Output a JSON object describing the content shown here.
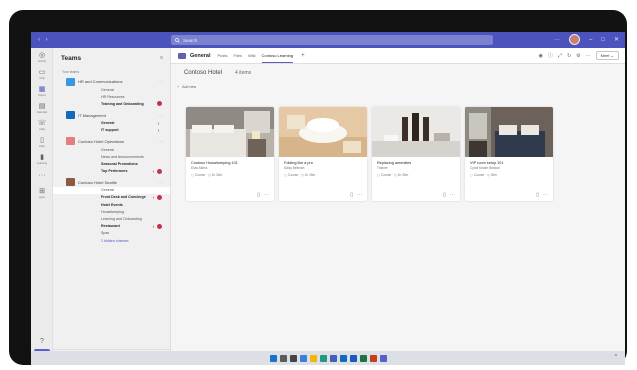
{
  "titlebar": {
    "nav": "‹ ›",
    "search_placeholder": "Search",
    "more": "···",
    "min": "–",
    "max": "□",
    "close": "✕"
  },
  "rail": {
    "items": [
      {
        "label": "Activity",
        "icon": "bell-icon",
        "glyph": "◎"
      },
      {
        "label": "Chat",
        "icon": "chat-icon",
        "glyph": "▭"
      },
      {
        "label": "Teams",
        "icon": "teams-icon",
        "glyph": "▦"
      },
      {
        "label": "Calendar",
        "icon": "calendar-icon",
        "glyph": "▤"
      },
      {
        "label": "Calls",
        "icon": "phone-icon",
        "glyph": "☏"
      },
      {
        "label": "Files",
        "icon": "file-icon",
        "glyph": "▯"
      },
      {
        "label": "Learning",
        "icon": "learning-icon",
        "glyph": "▮"
      },
      {
        "label": "",
        "icon": "more-icon",
        "glyph": "···"
      },
      {
        "label": "Apps",
        "icon": "apps-icon",
        "glyph": "⊞"
      }
    ],
    "help_glyph": "?"
  },
  "teams_panel": {
    "title": "Teams",
    "filter_glyph": "≡",
    "section": "Your teams",
    "teams": [
      {
        "name": "HR and Communications",
        "tile_color": "#3a96dd",
        "channels": [
          {
            "name": "General",
            "bold": false
          },
          {
            "name": "HR Resources",
            "bold": false
          },
          {
            "name": "Training and Onboarding",
            "bold": true,
            "badge": true
          }
        ]
      },
      {
        "name": "IT Management",
        "tile_color": "#0f6cbd",
        "channels": [
          {
            "name": "General",
            "bold": true,
            "mention": "!"
          },
          {
            "name": "IT support",
            "bold": true,
            "mention": "!"
          }
        ]
      },
      {
        "name": "Contoso Hotel Operations",
        "tile_color": "#e37d80",
        "channels": [
          {
            "name": "General",
            "bold": false
          },
          {
            "name": "News and Announcements",
            "bold": false
          },
          {
            "name": "Seasonal Promotions",
            "bold": true
          },
          {
            "name": "Top Performers",
            "bold": true,
            "mention": "!",
            "badge": true
          }
        ]
      },
      {
        "name": "Contoso Hotel Seattle",
        "tile_color": "#8a5a44",
        "channels": [
          {
            "name": "General",
            "bold": false,
            "selected": true
          },
          {
            "name": "Front Desk and Concierge",
            "bold": true,
            "mention": "!",
            "badge": true
          },
          {
            "name": "Hotel Events",
            "bold": true
          },
          {
            "name": "Housekeeping",
            "bold": false
          },
          {
            "name": "Learning and Onboarding",
            "bold": false
          },
          {
            "name": "Restaurant",
            "bold": true,
            "mention": "!",
            "badge": true
          },
          {
            "name": "Spas",
            "bold": false
          },
          {
            "name": "1 hidden channel",
            "bold": false,
            "link": true
          }
        ]
      }
    ],
    "footer": {
      "join_text": "Join or create a team",
      "gear_glyph": "⚙"
    }
  },
  "channel_bar": {
    "title": "General",
    "tabs": [
      "Posts",
      "Files",
      "Wiki",
      "Contoso Learning"
    ],
    "active_tab": 3,
    "add_glyph": "+",
    "meet_label": "Meet"
  },
  "subheader": {
    "title": "Contoso Hotel",
    "count": "4 items",
    "add_new": "Add new"
  },
  "cards": [
    {
      "title": "Contoso Housekeeping 101",
      "author": "Elvia Atkins",
      "type": "Course",
      "duration": "1h 30m"
    },
    {
      "title": "Folding like a pro",
      "author": "Daisy Bellman",
      "type": "Course",
      "duration": "1h 15m"
    },
    {
      "title": "Replacing amenities",
      "author": "Trainee",
      "type": "Course",
      "duration": "1h 30m"
    },
    {
      "title": "VIP room setup 101",
      "author": "Cyndi Kinder Bristow",
      "type": "Course",
      "duration": "30m"
    }
  ],
  "taskbar": {
    "apps": [
      {
        "icon": "windows-icon",
        "color": "#1a73c9"
      },
      {
        "icon": "search-icon",
        "color": "#5b5b5b"
      },
      {
        "icon": "taskview-icon",
        "color": "#444444"
      },
      {
        "icon": "widgets-icon",
        "color": "#3b80d8"
      },
      {
        "icon": "explorer-icon",
        "color": "#f2b705"
      },
      {
        "icon": "edge-icon",
        "color": "#1f9b7d"
      },
      {
        "icon": "store-icon",
        "color": "#4460b4"
      },
      {
        "icon": "outlook-icon",
        "color": "#0f6cbd"
      },
      {
        "icon": "word-icon",
        "color": "#185abd"
      },
      {
        "icon": "excel-icon",
        "color": "#1f7244"
      },
      {
        "icon": "powerpoint-icon",
        "color": "#c43e1c"
      },
      {
        "icon": "teams-app-icon",
        "color": "#5b5fc7"
      }
    ],
    "chevron": "^"
  }
}
